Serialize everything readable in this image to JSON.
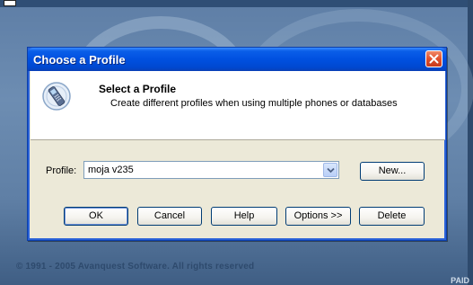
{
  "background": {
    "copyright": "© 1991 - 2005 Avanquest Software. All rights reserved",
    "corner_text": "PAID"
  },
  "dialog": {
    "title": "Choose a Profile",
    "header": {
      "icon": "phone-icon",
      "title": "Select a Profile",
      "subtitle": "Create different profiles when using multiple phones or databases"
    },
    "profile": {
      "label": "Profile:",
      "selected": "moja v235"
    },
    "buttons": {
      "new": "New...",
      "ok": "OK",
      "cancel": "Cancel",
      "help": "Help",
      "options": "Options >>",
      "delete": "Delete"
    }
  },
  "colors": {
    "titlebar": "#0050e0",
    "dialog_bg": "#ece9d8",
    "close_button": "#e0502c"
  }
}
